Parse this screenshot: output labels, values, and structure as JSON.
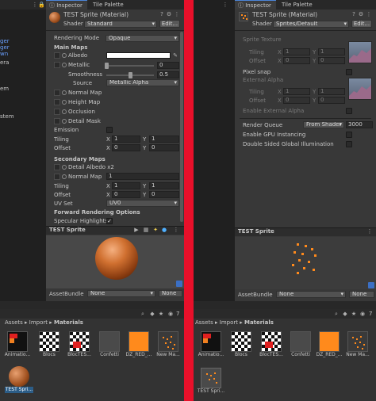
{
  "colors": {
    "accent_divider": "#e8102a",
    "orange": "#ff8a1c",
    "selection": "#2c5d87",
    "panel_bg": "#383838"
  },
  "left_hierarchy": {
    "fragments": [
      "ger",
      "ger",
      "wn",
      "era",
      "em",
      "stem"
    ]
  },
  "left_inspector": {
    "tab_inspector": "Inspector",
    "tab_palette": "Tile Palette",
    "title": "TEST Sprite (Material)",
    "shader_label": "Shader",
    "shader_value": "Standard",
    "edit_button": "Edit...",
    "rendering_mode_label": "Rendering Mode",
    "rendering_mode_value": "Opaque",
    "main_maps": "Main Maps",
    "albedo": "Albedo",
    "metallic": "Metallic",
    "metallic_value": "0",
    "smoothness": "Smoothness",
    "smoothness_value": "0.5",
    "source": "Source",
    "source_value": "Metallic Alpha",
    "normal_map": "Normal Map",
    "height_map": "Height Map",
    "occlusion": "Occlusion",
    "detail_mask": "Detail Mask",
    "emission": "Emission",
    "tiling": "Tiling",
    "offset": "Offset",
    "x": "X",
    "y": "Y",
    "tiling_x": "1",
    "tiling_y": "1",
    "offset_x": "0",
    "offset_y": "0",
    "secondary_maps": "Secondary Maps",
    "detail_albedo": "Detail Albedo x2",
    "normal_map2": "Normal Map",
    "normal_map2_value": "1",
    "tiling2_x": "1",
    "tiling2_y": "1",
    "offset2_x": "0",
    "offset2_y": "0",
    "uv_set": "UV Set",
    "uv_set_value": "UV0",
    "forward_rendering": "Forward Rendering Options",
    "specular_highlights": "Specular Highlights",
    "preview_title": "TEST Sprite",
    "assetbundle": "AssetBundle",
    "assetbundle_value": "None",
    "assetbundle_variant": "None"
  },
  "right_inspector": {
    "tab_inspector": "Inspector",
    "tab_palette": "Tile Palette",
    "title": "TEST Sprite (Material)",
    "shader_label": "Shader",
    "shader_value": "Sprites/Default",
    "edit_button": "Edit...",
    "sprite_texture": "Sprite Texture",
    "tiling": "Tiling",
    "offset": "Offset",
    "x": "X",
    "y": "Y",
    "one": "1",
    "zero": "0",
    "pixel_snap": "Pixel snap",
    "external_alpha": "External Alpha",
    "enable_external_alpha": "Enable External Alpha",
    "render_queue": "Render Queue",
    "render_queue_mode": "From Shader",
    "render_queue_value": "3000",
    "gpu_instancing": "Enable GPU Instancing",
    "double_sided": "Double Sided Global Illumination",
    "preview_title": "TEST Sprite",
    "assetbundle": "AssetBundle",
    "assetbundle_value": "None",
    "assetbundle_variant": "None"
  },
  "left_project": {
    "breadcrumb_root": "Assets",
    "breadcrumb_mid": "Import",
    "breadcrumb_leaf": "Materials",
    "count_badge": "7",
    "assets": [
      "Animatio...",
      "Blocs",
      "BlocTES...",
      "Confetti",
      "DZ_RED_...",
      "New Ma...",
      "TEST Spri..."
    ]
  },
  "right_project": {
    "breadcrumb_root": "Assets",
    "breadcrumb_mid": "Import",
    "breadcrumb_leaf": "Materials",
    "count_badge": "7",
    "assets": [
      "Animatio...",
      "Blocs",
      "BlocTES...",
      "Confetti",
      "DZ_RED_...",
      "New Ma...",
      "TEST Spri..."
    ]
  }
}
